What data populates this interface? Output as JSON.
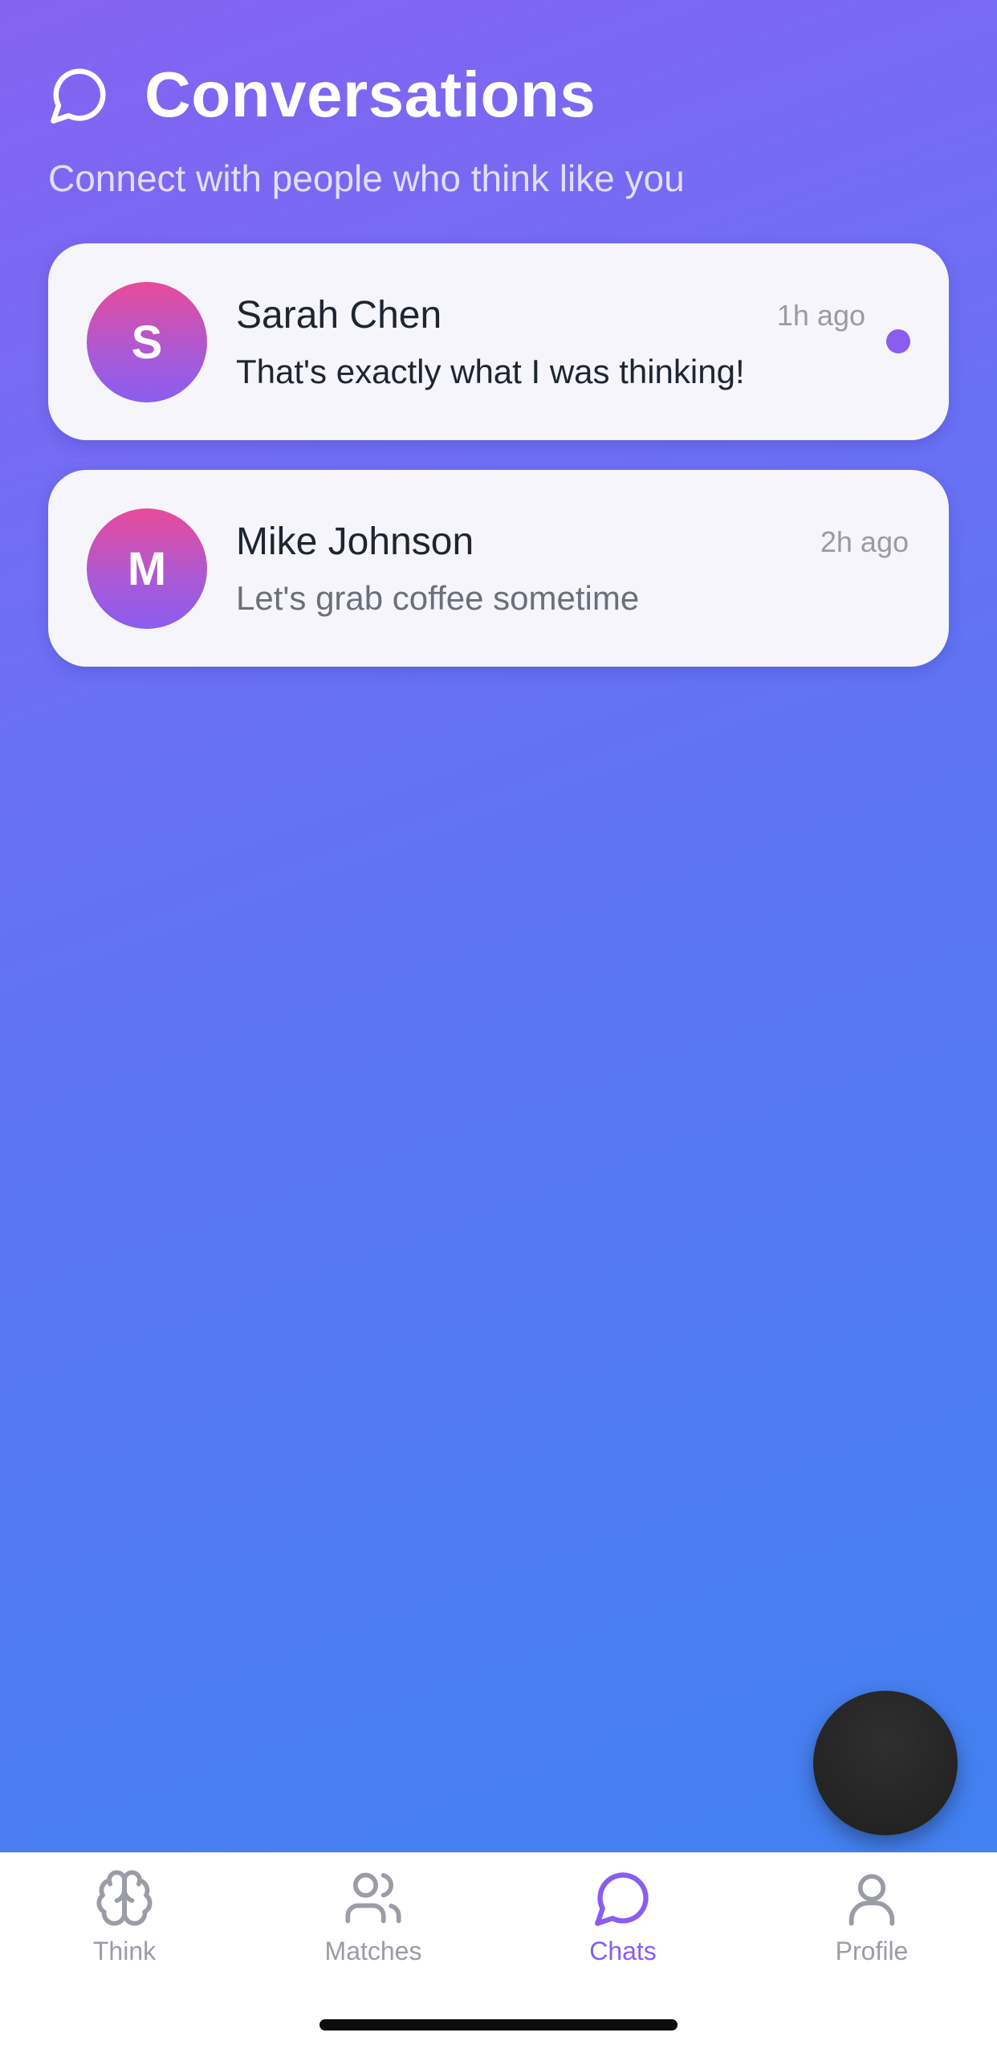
{
  "header": {
    "title": "Conversations",
    "subtitle": "Connect with people who think like you",
    "icon": "chat-bubble-icon"
  },
  "conversations": [
    {
      "initial": "S",
      "name": "Sarah Chen",
      "time": "1h ago",
      "message": "That's exactly what I was thinking!",
      "unread": true
    },
    {
      "initial": "M",
      "name": "Mike Johnson",
      "time": "2h ago",
      "message": "Let's grab coffee sometime",
      "unread": false
    }
  ],
  "tabs": [
    {
      "label": "Think",
      "icon": "brain-icon",
      "active": false
    },
    {
      "label": "Matches",
      "icon": "users-icon",
      "active": false
    },
    {
      "label": "Chats",
      "icon": "chat-bubble-icon",
      "active": true
    },
    {
      "label": "Profile",
      "icon": "user-icon",
      "active": false
    }
  ],
  "colors": {
    "accent": "#8a5cf0",
    "gradient_top": "#8563f1",
    "gradient_bottom": "#3d83f0",
    "avatar_gradient_start": "#e84b9a",
    "card_background": "#f5f5fb",
    "fab": "#222222"
  }
}
